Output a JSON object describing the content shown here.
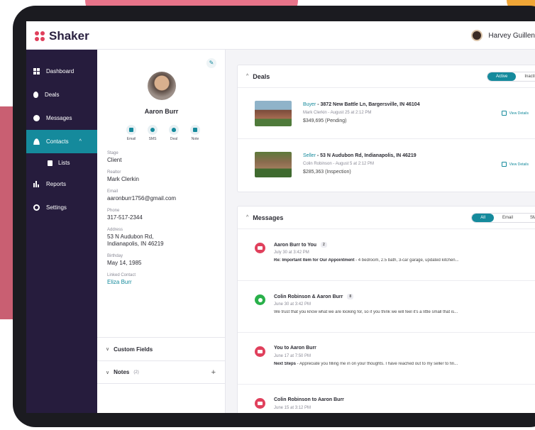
{
  "app": {
    "name": "Shaker"
  },
  "user": {
    "name": "Harvey Guillen"
  },
  "sidebar": {
    "items": [
      {
        "label": "Dashboard"
      },
      {
        "label": "Deals"
      },
      {
        "label": "Messages"
      },
      {
        "label": "Contacts"
      },
      {
        "label": "Lists"
      },
      {
        "label": "Reports"
      },
      {
        "label": "Settings"
      }
    ]
  },
  "contact": {
    "name": "Aaron Burr",
    "actions": [
      "Email",
      "SMS",
      "Deal",
      "Note"
    ],
    "fields": {
      "stage": {
        "label": "Stage",
        "value": "Client"
      },
      "realtor": {
        "label": "Realtor",
        "value": "Mark Clerkin"
      },
      "email": {
        "label": "Email",
        "value": "aaronburr1756@gmail.com"
      },
      "phone": {
        "label": "Phone",
        "value": "317-517-2344"
      },
      "address": {
        "label": "Address",
        "line1": "53 N Audubon Rd,",
        "line2": "Indianapolis, IN 46219"
      },
      "birthday": {
        "label": "Birthday",
        "value": "May 14, 1985"
      },
      "linked": {
        "label": "Linked Contact",
        "value": "Eliza Burr"
      }
    },
    "custom_fields_label": "Custom Fields",
    "notes_label": "Notes",
    "notes_count": "(2)"
  },
  "deals": {
    "title": "Deals",
    "filters": [
      "Active",
      "Inactive"
    ],
    "view_label": "View Details",
    "items": [
      {
        "role": "Buyer",
        "title": " - 3872 New Battle Ln, Bargersville, IN 46104",
        "meta": "Mark Clerkin - August 25 at 2:12 PM",
        "price": "$349,695 (Pending)"
      },
      {
        "role": "Seller",
        "title": " - 53 N Audubon Rd, Indianapolis, IN 46219",
        "meta": "Colin Robinson - August 5 at 2:12 PM",
        "price": "$285,363 (Inspection)"
      }
    ]
  },
  "messages": {
    "title": "Messages",
    "filters": [
      "All",
      "Email",
      "SMS"
    ],
    "items": [
      {
        "title": "Aaron Burr to You",
        "count": "2",
        "date": "July 30 at 3:42 PM",
        "subject": "Re: Important Item for Our Appointment",
        "preview": " - 4 bedroom, 2.5 bath, 3-car garage, updated kitchen..."
      },
      {
        "title": "Colin Robinson & Aaron Burr",
        "count": "8",
        "date": "June 30 at 3:42 PM",
        "subject": "",
        "preview": "We trust that you know what we are looking for, so if you think we will feel it's a little small that is..."
      },
      {
        "title": "You to Aaron Burr",
        "count": "",
        "date": "June 17 at 7:50 PM",
        "subject": "Next Steps",
        "preview": " - Appreciate you filling me in on your thoughts.  I have reached out to my seller to fin..."
      },
      {
        "title": "Colin Robinson to Aaron Burr",
        "count": "",
        "date": "June 15 at 3:12 PM",
        "subject": "",
        "preview": ""
      }
    ]
  },
  "colors": {
    "accent": "#158a9c",
    "sidebar": "#261c3d",
    "brand": "#e0405c",
    "sms": "#29b04a"
  }
}
